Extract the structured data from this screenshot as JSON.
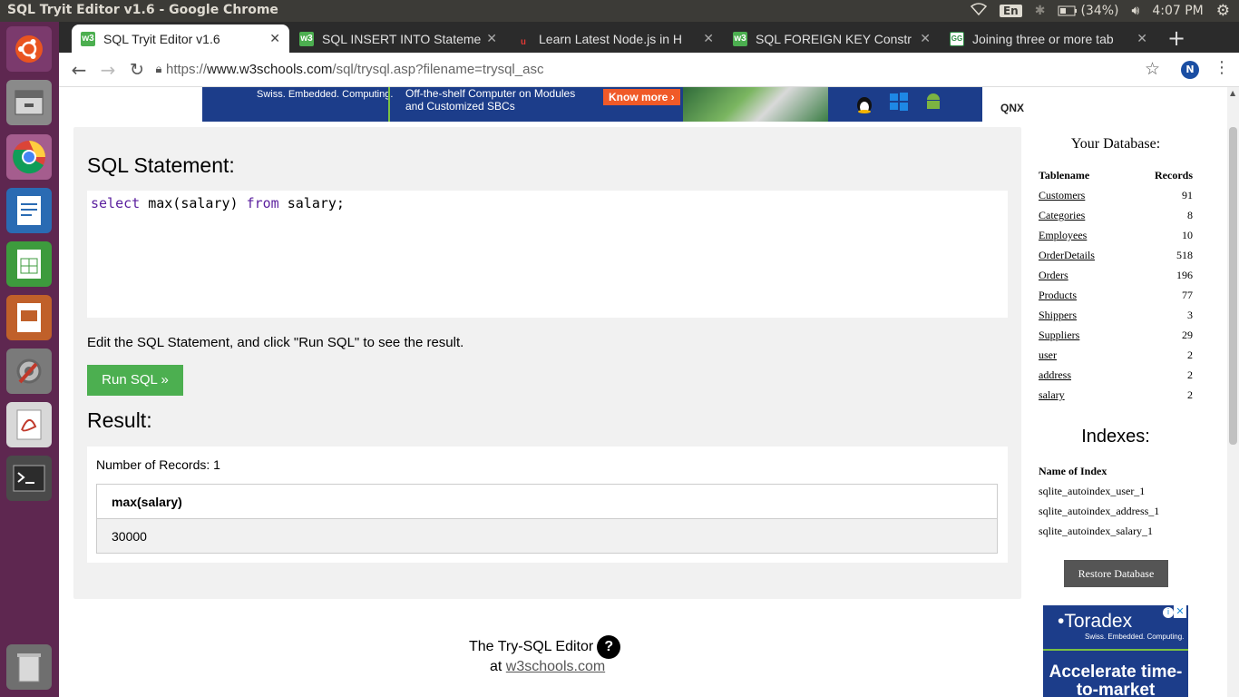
{
  "system": {
    "window_title": "SQL Tryit Editor v1.6 - Google Chrome",
    "keyboard_layout": "En",
    "battery": "(34%)",
    "clock": "4:07 PM"
  },
  "launcher": {
    "items": [
      "ubuntu-dash-icon",
      "files-icon",
      "chrome-icon",
      "writer-icon",
      "calc-icon",
      "impress-icon",
      "settings-icon",
      "pdf-viewer-icon",
      "terminal-icon",
      "trash-icon"
    ]
  },
  "tabs": [
    {
      "label": "SQL Tryit Editor v1.6",
      "icon": "w3schools-icon",
      "active": true
    },
    {
      "label": "SQL INSERT INTO Stateme",
      "icon": "w3schools-icon",
      "active": false
    },
    {
      "label": "Learn Latest Node.js in H",
      "icon": "nodejs-course-icon",
      "active": false
    },
    {
      "label": "SQL FOREIGN KEY Constr",
      "icon": "w3schools-icon",
      "active": false
    },
    {
      "label": "Joining three or more tab",
      "icon": "geeksforgeeks-icon",
      "active": false
    }
  ],
  "toolbar": {
    "url_prefix": "https://",
    "url_host": "www.w3schools.com",
    "url_path": "/sql/trysql.asp?filename=trysql_asc",
    "profile_initial": "N"
  },
  "top_ad": {
    "tagline": "Swiss. Embedded. Computing.",
    "text": "Off-the-shelf Computer on Modules and Customized SBCs",
    "cta": "Know more ›",
    "brand": "QNX"
  },
  "editor": {
    "heading": "SQL Statement:",
    "code_kw1": "select",
    "code_mid": " max(salary) ",
    "code_kw2": "from",
    "code_end": " salary;",
    "hint": "Edit the SQL Statement, and click \"Run SQL\" to see the result.",
    "run_label": "Run SQL »"
  },
  "result": {
    "heading": "Result:",
    "record_count": "Number of Records: 1",
    "column": "max(salary)",
    "value": "30000"
  },
  "database": {
    "heading": "Your Database:",
    "col_table": "Tablename",
    "col_records": "Records",
    "tables": [
      {
        "name": "Customers",
        "records": "91"
      },
      {
        "name": "Categories",
        "records": "8"
      },
      {
        "name": "Employees",
        "records": "10"
      },
      {
        "name": "OrderDetails",
        "records": "518"
      },
      {
        "name": "Orders",
        "records": "196"
      },
      {
        "name": "Products",
        "records": "77"
      },
      {
        "name": "Shippers",
        "records": "3"
      },
      {
        "name": "Suppliers",
        "records": "29"
      },
      {
        "name": "user",
        "records": "2"
      },
      {
        "name": "address",
        "records": "2"
      },
      {
        "name": "salary",
        "records": "2"
      }
    ],
    "indexes_heading": "Indexes:",
    "index_col": "Name of Index",
    "indexes": [
      "sqlite_autoindex_user_1",
      "sqlite_autoindex_address_1",
      "sqlite_autoindex_salary_1"
    ],
    "restore_label": "Restore Database"
  },
  "side_ad": {
    "brand": "Toradex",
    "tagline": "Swiss. Embedded. Computing.",
    "headline": "Accelerate time-to-market"
  },
  "footer": {
    "line1": "The Try-SQL Editor",
    "help": "?",
    "at": "at",
    "link": "w3schools.com"
  },
  "colors": {
    "launcher_bg": "#5e2750",
    "run_button": "#4caf50",
    "ad_blue": "#1c3d8a",
    "ad_green": "#7ac143",
    "sql_keyword": "#5a1f9e"
  }
}
